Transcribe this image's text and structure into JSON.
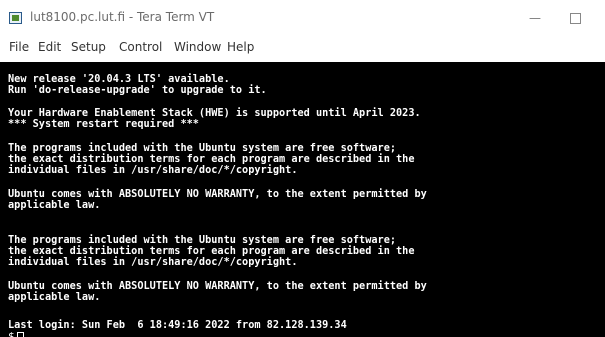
{
  "window": {
    "title": "lut8100.pc.lut.fi - Tera Term VT",
    "minimize_glyph": "—"
  },
  "menu": {
    "items": [
      "File",
      "Edit",
      "Setup",
      "Control",
      "Window",
      "Help"
    ]
  },
  "terminal": {
    "lines": [
      "New release '20.04.3 LTS' available.",
      "Run 'do-release-upgrade' to upgrade to it.",
      "Your Hardware Enablement Stack (HWE) is supported until April 2023.",
      "*** System restart required ***",
      "The programs included with the Ubuntu system are free software;",
      "the exact distribution terms for each program are described in the",
      "individual files in /usr/share/doc/*/copyright.",
      "Ubuntu comes with ABSOLUTELY NO WARRANTY, to the extent permitted by",
      "applicable law.",
      "The programs included with the Ubuntu system are free software;",
      "the exact distribution terms for each program are described in the",
      "individual files in /usr/share/doc/*/copyright.",
      "Ubuntu comes with ABSOLUTELY NO WARRANTY, to the extent permitted by",
      "applicable law.",
      "Last login: Sun Feb  6 18:49:16 2022 from 82.128.139.34"
    ],
    "prompt": "$",
    "colors": {
      "background": "#000000",
      "foreground": "#ffffff"
    }
  }
}
